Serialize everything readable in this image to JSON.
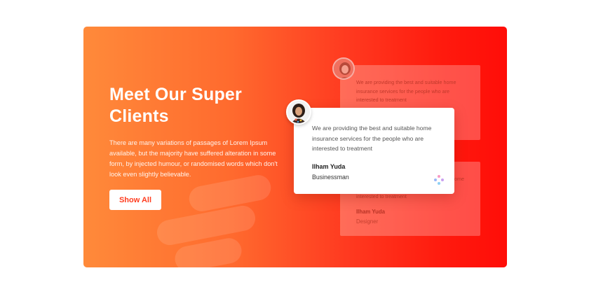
{
  "hero": {
    "title_line1": "Meet Our Super",
    "title_line2": "Clients",
    "description": "There are many variations of passages of Lorem Ipsum available, but the majority have suffered alteration in some form, by injected humour, or randomised words which don't look even slightly believable.",
    "button_label": "Show All"
  },
  "testimonials": {
    "front": {
      "quote": "We are providing the best and suitable home insurance services for the people who are interested to treatment",
      "name": "Ilham Yuda",
      "role": "Businessman"
    },
    "back_top": {
      "quote": "We are providing the best and suitable home insurance services for the people who are interested to treatment"
    },
    "back_bottom": {
      "quote_visible_tail1": "ome",
      "quote_visible_tail2": "interested to treatment",
      "name": "Ilham Yuda",
      "role": "Designer"
    }
  },
  "colors": {
    "gradient_start": "#ff8a3a",
    "gradient_end": "#ff0d08",
    "button_text": "#ff3d1f",
    "dots": [
      "#f79ac6",
      "#9ab8f7",
      "#c9a0f0",
      "#8fd0f5"
    ]
  },
  "icons": {
    "front_avatar": "avatar-woman-icon",
    "back_avatar": "avatar-woman-icon",
    "dots": "dots-icon"
  }
}
